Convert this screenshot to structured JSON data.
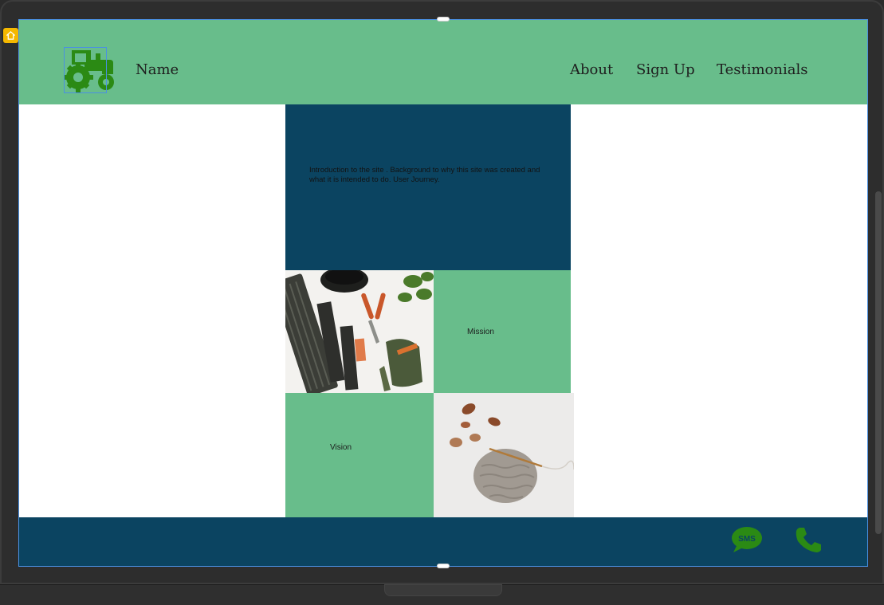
{
  "header": {
    "brand_name": "Name",
    "nav": [
      {
        "label": "About"
      },
      {
        "label": "Sign Up"
      },
      {
        "label": "Testimonials"
      }
    ]
  },
  "intro": {
    "text": "Introduction to the site . Background to why this site was created and what it is intended to do. User Journey."
  },
  "mission": {
    "label": "Mission"
  },
  "vision": {
    "label": "Vision"
  },
  "footer": {
    "sms_text": "SMS"
  },
  "icons": {
    "logo": "tractor-icon",
    "sms": "sms-chat-icon",
    "phone": "phone-icon",
    "badge": "home-icon"
  },
  "colors": {
    "header_green": "#68bd8b",
    "navy": "#0b4461",
    "icon_green": "#2b8a14",
    "selection_blue": "#4a90e2"
  }
}
